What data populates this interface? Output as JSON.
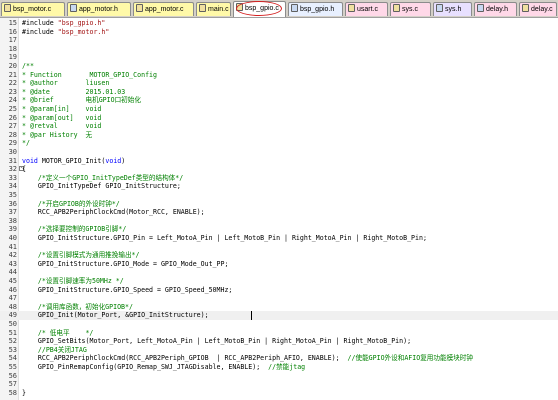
{
  "tabs": [
    {
      "label": "bsp_motor.c",
      "color": "#fff9a8",
      "icon": "c-file-icon"
    },
    {
      "label": "app_motor.h",
      "color": "#fff9a8",
      "icon": "h-file-icon"
    },
    {
      "label": "app_motor.c",
      "color": "#fff9a8",
      "icon": "c-file-icon"
    },
    {
      "label": "main.c",
      "color": "#fff9a8",
      "icon": "c-file-icon"
    },
    {
      "label": "bsp_gpio.c",
      "color": "#ffffff",
      "icon": "c-file-icon",
      "active": true
    },
    {
      "label": "bsp_gpio.h",
      "color": "#e8f0ff",
      "icon": "h-file-icon"
    },
    {
      "label": "usart.c",
      "color": "#ffd8e8",
      "icon": "c-file-icon"
    },
    {
      "label": "sys.c",
      "color": "#ffd8e8",
      "icon": "c-file-icon"
    },
    {
      "label": "sys.h",
      "color": "#e8e0ff",
      "icon": "h-file-icon"
    },
    {
      "label": "delay.h",
      "color": "#ffd8e8",
      "icon": "h-file-icon"
    },
    {
      "label": "delay.c",
      "color": "#ffd8e8",
      "icon": "c-file-icon"
    }
  ],
  "colors": {
    "keyword": "#0000ff",
    "comment": "#008000",
    "string": "#a31515",
    "text": "#000000",
    "active_ring": "#d42020"
  },
  "code_lines": [
    {
      "n": "15",
      "parts": [
        [
          "#include ",
          "text"
        ],
        [
          "\"bsp_gpio.h\"",
          "string"
        ]
      ]
    },
    {
      "n": "16",
      "parts": [
        [
          "#include ",
          "text"
        ],
        [
          "\"bsp_motor.h\"",
          "string"
        ]
      ]
    },
    {
      "n": "17",
      "parts": []
    },
    {
      "n": "18",
      "parts": []
    },
    {
      "n": "19",
      "parts": []
    },
    {
      "n": "20",
      "parts": [
        [
          "/**",
          "comment"
        ]
      ]
    },
    {
      "n": "21",
      "parts": [
        [
          "* Function       MOTOR_GPIO_Config",
          "comment"
        ]
      ]
    },
    {
      "n": "22",
      "parts": [
        [
          "* @author       liusen",
          "comment"
        ]
      ]
    },
    {
      "n": "23",
      "parts": [
        [
          "* @date         2015.01.03",
          "comment"
        ]
      ]
    },
    {
      "n": "24",
      "parts": [
        [
          "* @brief        电机GPIO口初始化",
          "comment"
        ]
      ]
    },
    {
      "n": "25",
      "parts": [
        [
          "* @param[in]    void",
          "comment"
        ]
      ]
    },
    {
      "n": "26",
      "parts": [
        [
          "* @param[out]   void",
          "comment"
        ]
      ]
    },
    {
      "n": "27",
      "parts": [
        [
          "* @retval       void",
          "comment"
        ]
      ]
    },
    {
      "n": "28",
      "parts": [
        [
          "* @par History  无",
          "comment"
        ]
      ]
    },
    {
      "n": "29",
      "parts": [
        [
          "*/",
          "comment"
        ]
      ]
    },
    {
      "n": "30",
      "parts": []
    },
    {
      "n": "31",
      "parts": [
        [
          "void ",
          "keyword"
        ],
        [
          "MOTOR_GPIO_Init(",
          "text"
        ],
        [
          "void",
          "keyword"
        ],
        [
          ")",
          "text"
        ]
      ]
    },
    {
      "n": "32",
      "parts": [
        [
          "{",
          "text"
        ]
      ],
      "fold": "-"
    },
    {
      "n": "33",
      "parts": [
        [
          "    /*定义一个GPIO_InitTypeDef类型的结构体*/",
          "comment"
        ]
      ]
    },
    {
      "n": "34",
      "parts": [
        [
          "    GPIO_InitTypeDef GPIO_InitStructure;",
          "text"
        ]
      ]
    },
    {
      "n": "35",
      "parts": []
    },
    {
      "n": "36",
      "parts": [
        [
          "    /*开启GPIOB的外设时钟*/",
          "comment"
        ]
      ]
    },
    {
      "n": "37",
      "parts": [
        [
          "    RCC_APB2PeriphClockCmd(Motor_RCC, ENABLE);",
          "text"
        ]
      ]
    },
    {
      "n": "38",
      "parts": []
    },
    {
      "n": "39",
      "parts": [
        [
          "    /*选择要控制的GPIOB引脚*/",
          "comment"
        ]
      ]
    },
    {
      "n": "40",
      "parts": [
        [
          "    GPIO_InitStructure.GPIO_Pin = Left_MotoA_Pin | Left_MotoB_Pin | Right_MotoA_Pin | Right_MotoB_Pin;",
          "text"
        ]
      ]
    },
    {
      "n": "41",
      "parts": []
    },
    {
      "n": "42",
      "parts": [
        [
          "    /*设置引脚模式为通用推挽输出*/",
          "comment"
        ]
      ]
    },
    {
      "n": "43",
      "parts": [
        [
          "    GPIO_InitStructure.GPIO_Mode = GPIO_Mode_Out_PP;",
          "text"
        ]
      ]
    },
    {
      "n": "44",
      "parts": []
    },
    {
      "n": "45",
      "parts": [
        [
          "    /*设置引脚速率为50MHz */",
          "comment"
        ]
      ]
    },
    {
      "n": "46",
      "parts": [
        [
          "    GPIO_InitStructure.GPIO_Speed = GPIO_Speed_50MHz;",
          "text"
        ]
      ]
    },
    {
      "n": "47",
      "parts": []
    },
    {
      "n": "48",
      "parts": [
        [
          "    /*调用库函数，初始化GPIOB*/",
          "comment"
        ]
      ]
    },
    {
      "n": "49",
      "parts": [
        [
          "    GPIO_Init(Motor_Port, &GPIO_InitStructure);",
          "text"
        ]
      ],
      "highlight": true
    },
    {
      "n": "50",
      "parts": []
    },
    {
      "n": "51",
      "parts": [
        [
          "    /* 低电平    */",
          "comment"
        ]
      ]
    },
    {
      "n": "52",
      "parts": [
        [
          "    GPIO_SetBits(Motor_Port, Left_MotoA_Pin | Left_MotoB_Pin | Right_MotoA_Pin | Right_MotoB_Pin);",
          "text"
        ]
      ]
    },
    {
      "n": "53",
      "parts": [
        [
          "    //PB4关闭JTAG",
          "comment"
        ]
      ]
    },
    {
      "n": "54",
      "parts": [
        [
          "    RCC_APB2PeriphClockCmd(RCC_APB2Periph_GPIOB  | RCC_APB2Periph_AFIO, ENABLE);  ",
          "text"
        ],
        [
          "//使能GPIO外设和AFIO复用功能模块时钟",
          "comment"
        ]
      ]
    },
    {
      "n": "55",
      "parts": [
        [
          "    GPIO_PinRemapConfig(GPIO_Remap_SWJ_JTAGDisable, ENABLE);  ",
          "text"
        ],
        [
          "//禁能jtag",
          "comment"
        ]
      ]
    },
    {
      "n": "56",
      "parts": []
    },
    {
      "n": "57",
      "parts": []
    },
    {
      "n": "58",
      "parts": [
        [
          "}",
          "text"
        ]
      ]
    }
  ]
}
